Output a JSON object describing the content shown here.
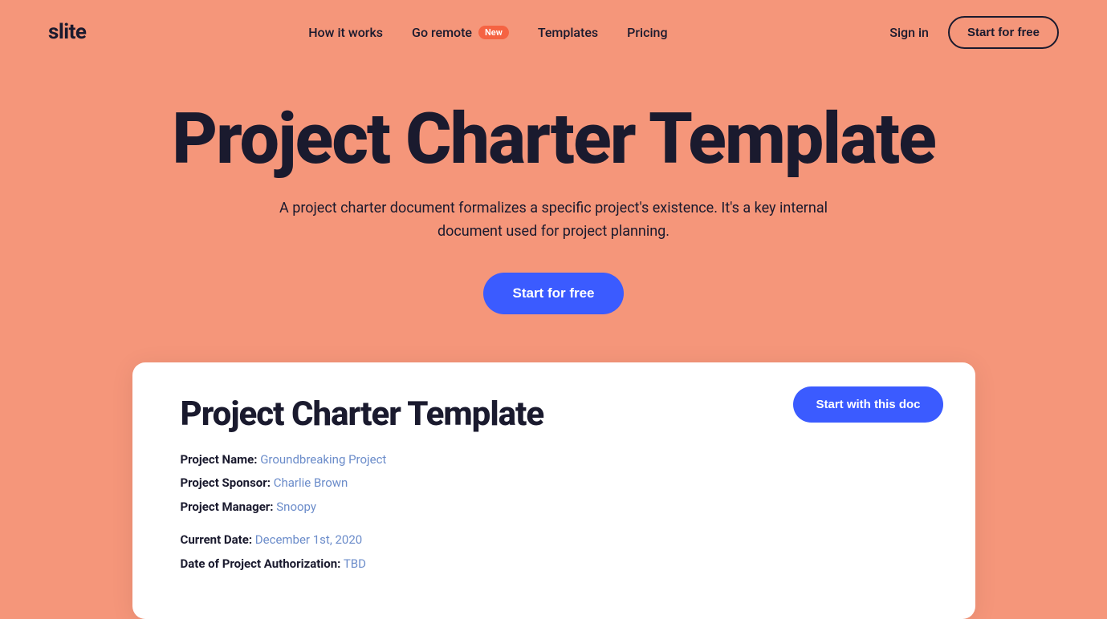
{
  "brand": {
    "logo": "slite"
  },
  "navbar": {
    "links": [
      {
        "id": "how-it-works",
        "label": "How it works"
      },
      {
        "id": "go-remote",
        "label": "Go remote",
        "badge": "New"
      },
      {
        "id": "templates",
        "label": "Templates"
      },
      {
        "id": "pricing",
        "label": "Pricing"
      }
    ],
    "signin_label": "Sign in",
    "start_free_label": "Start for free"
  },
  "hero": {
    "title": "Project Charter Template",
    "subtitle": "A project charter document formalizes a specific project's existence. It's a key internal document used for project planning.",
    "cta_label": "Start for free"
  },
  "doc_card": {
    "cta_label": "Start with this doc",
    "doc_title": "Project Charter Template",
    "fields_group1": [
      {
        "label": "Project Name:",
        "value": "Groundbreaking Project"
      },
      {
        "label": "Project Sponsor:",
        "value": "Charlie Brown"
      },
      {
        "label": "Project Manager:",
        "value": "Snoopy"
      }
    ],
    "fields_group2": [
      {
        "label": "Current Date:",
        "value": "December 1st, 2020"
      },
      {
        "label": "Date of Project Authorization:",
        "value": "TBD"
      }
    ]
  },
  "colors": {
    "background": "#F5967A",
    "accent_blue": "#3B5BFF",
    "badge_red": "#F56342",
    "text_dark": "#1a1a2e",
    "link_blue": "#6B8CCA"
  }
}
